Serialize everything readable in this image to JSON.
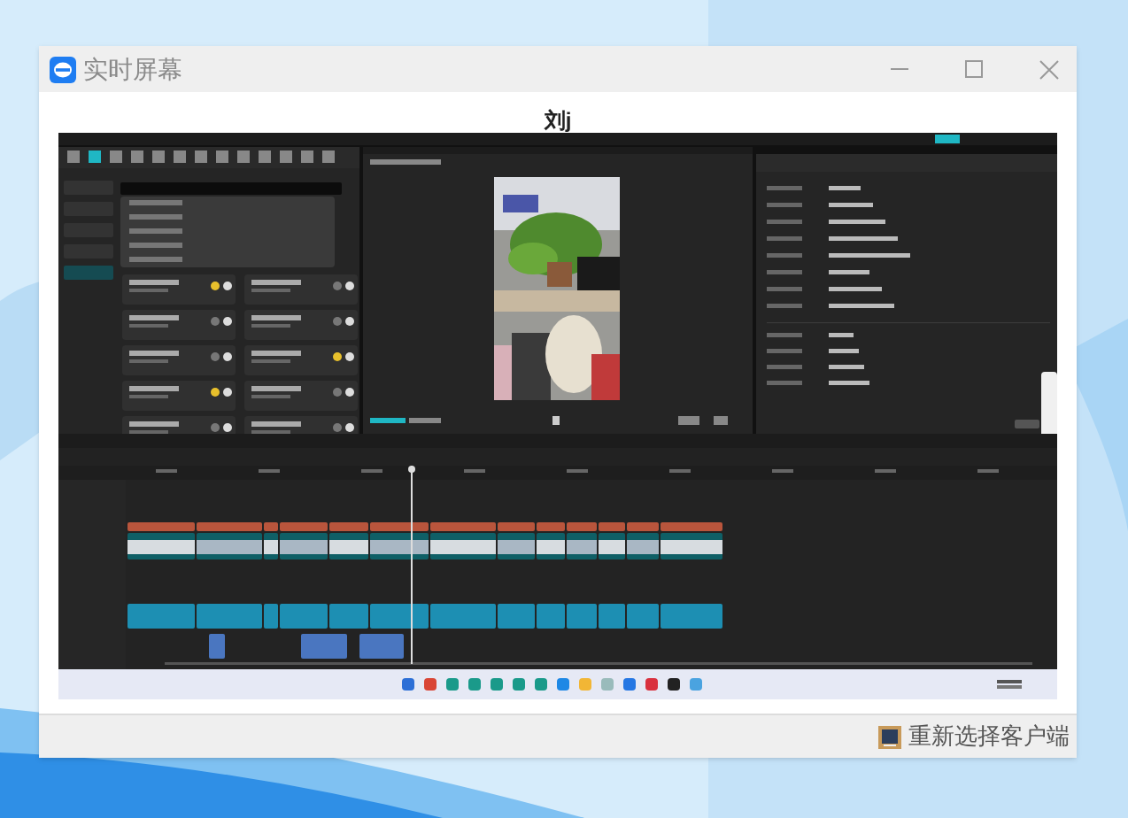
{
  "window": {
    "title": "实时屏幕"
  },
  "client": {
    "name": "刘j"
  },
  "footer": {
    "button": "重新选择客户端"
  }
}
